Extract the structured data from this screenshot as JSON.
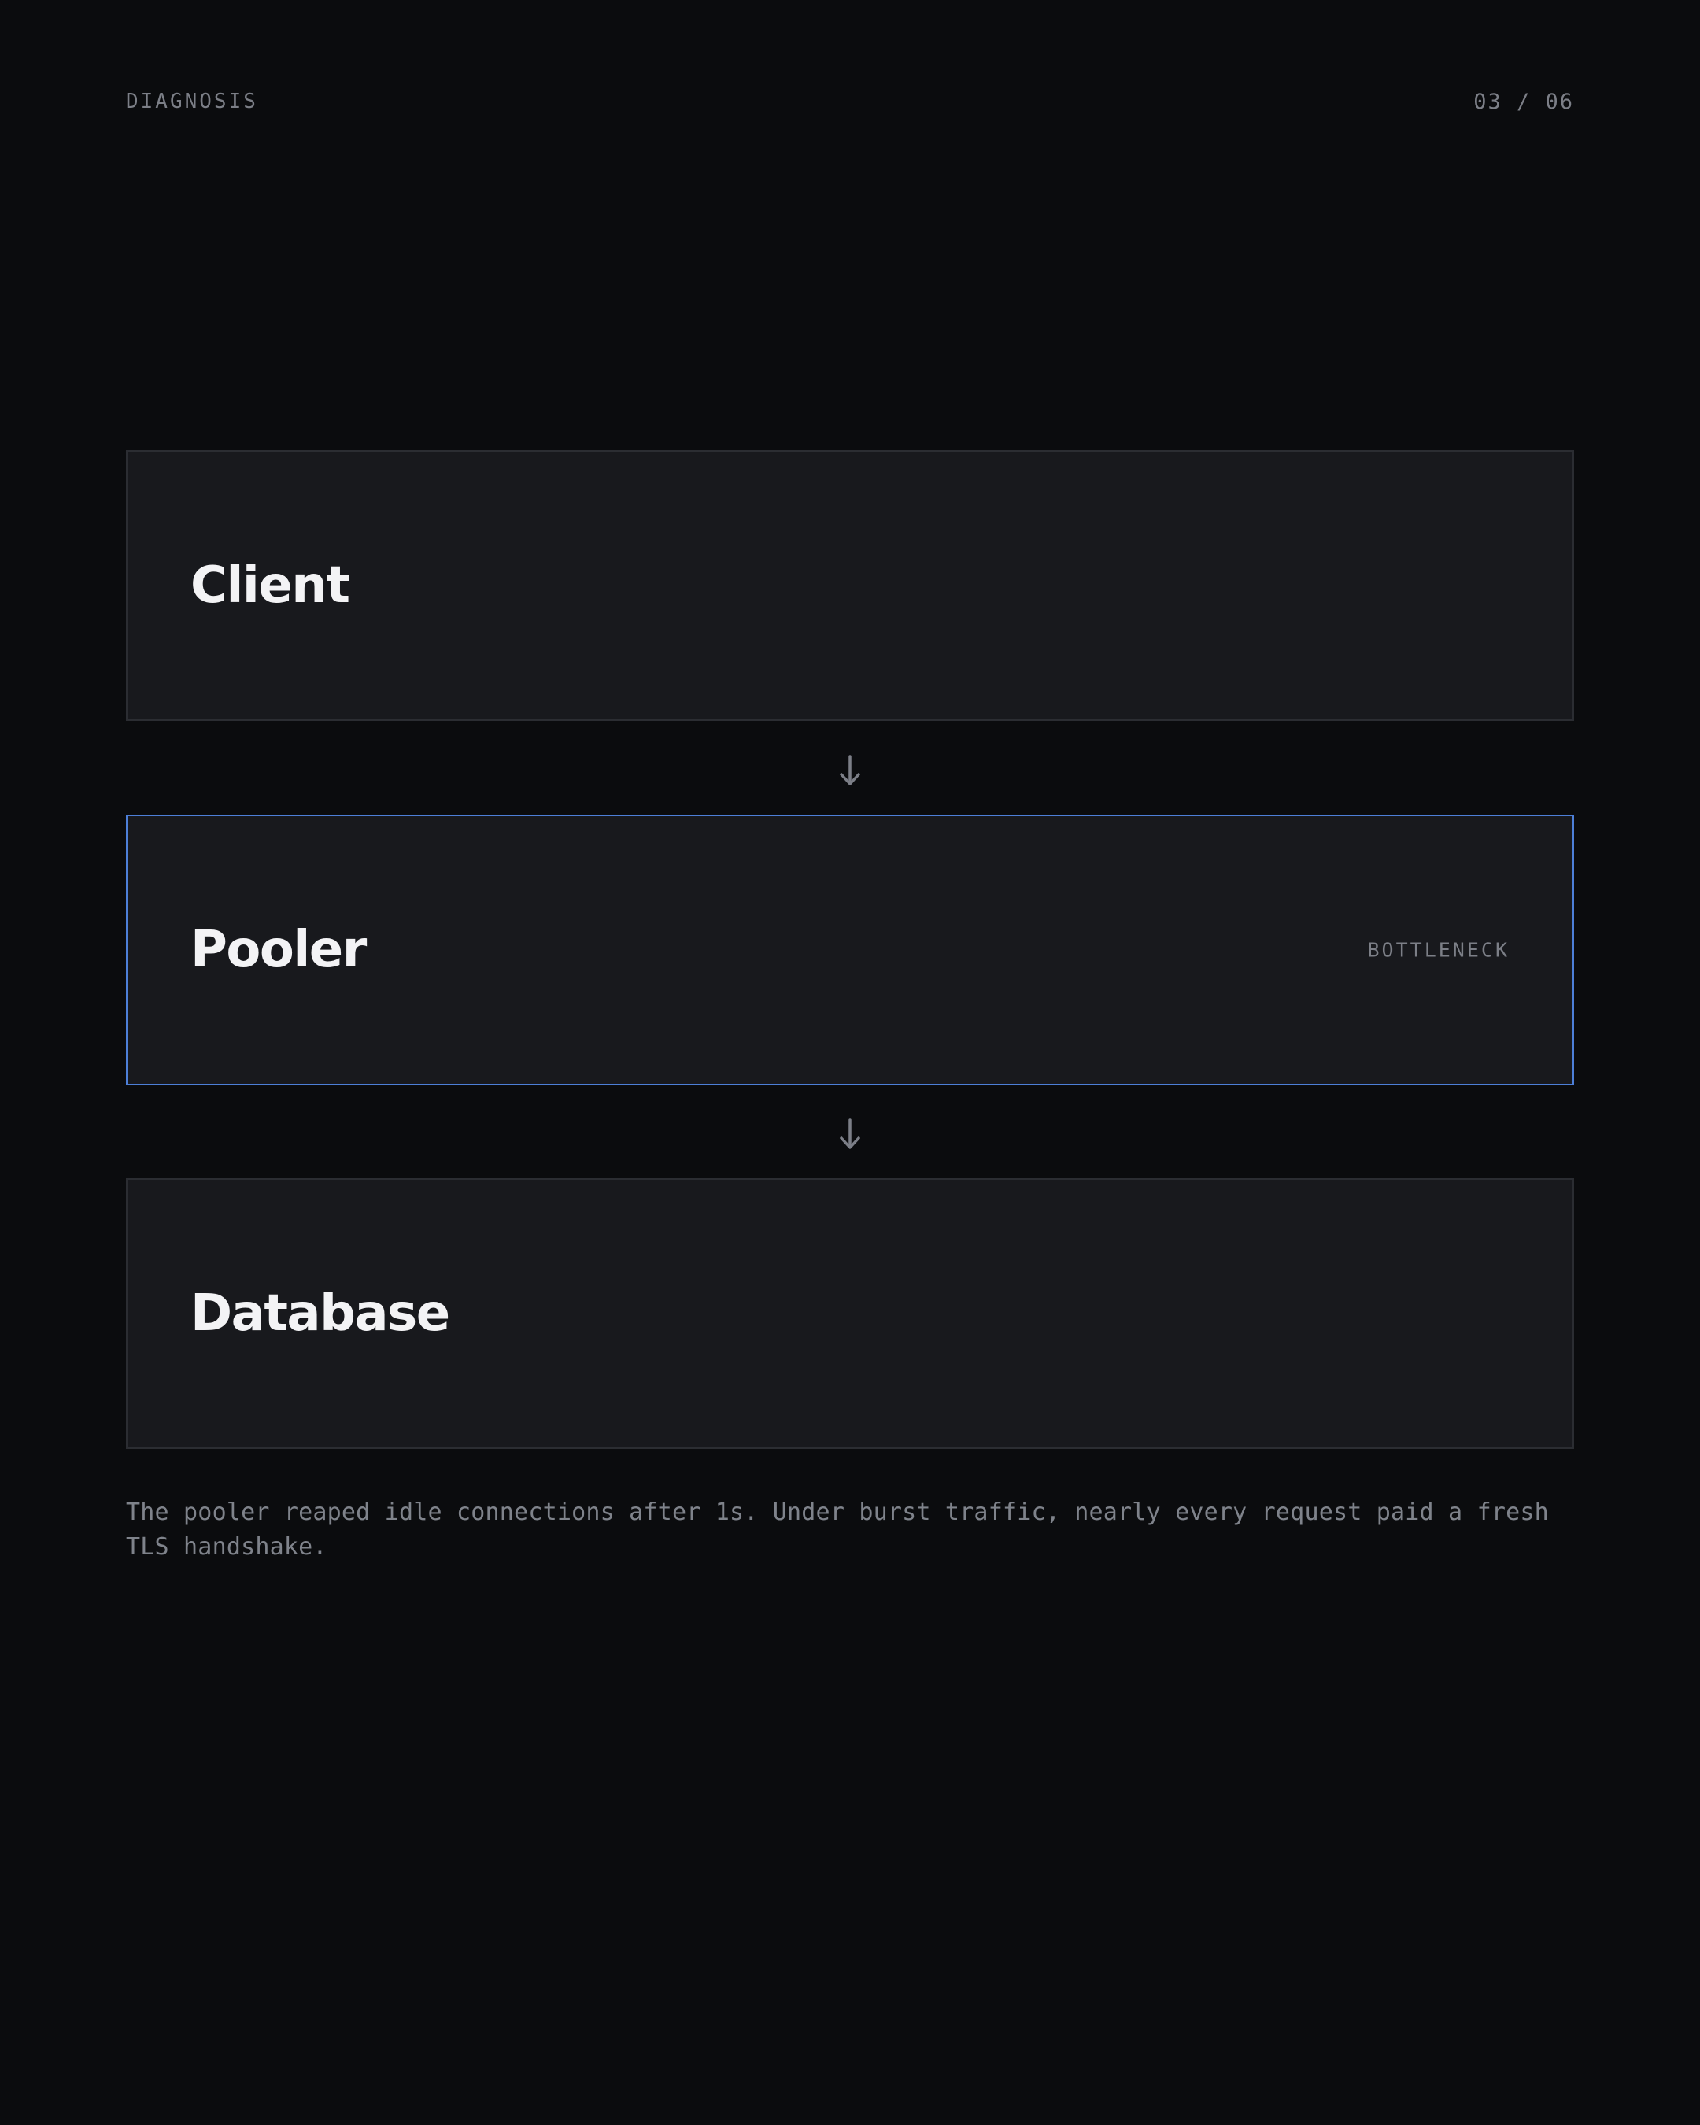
{
  "header": {
    "section_label": "DIAGNOSIS",
    "page_counter": "03 / 06"
  },
  "stages": [
    {
      "title": "Client",
      "tag": ""
    },
    {
      "title": "Pooler",
      "tag": "BOTTLENECK",
      "highlighted": true
    },
    {
      "title": "Database",
      "tag": ""
    }
  ],
  "connector_icon": "arrow-down-icon",
  "caption": "The pooler reaped idle connections after 1s. Under burst traffic, nearly every request paid a fresh TLS handshake.",
  "colors": {
    "background": "#0b0c0e",
    "card": "#18191d",
    "card_border": "#2b2d32",
    "highlight_border": "#4d7fd8",
    "muted_text": "#7c7f87",
    "title_text": "#f3f3f5"
  }
}
